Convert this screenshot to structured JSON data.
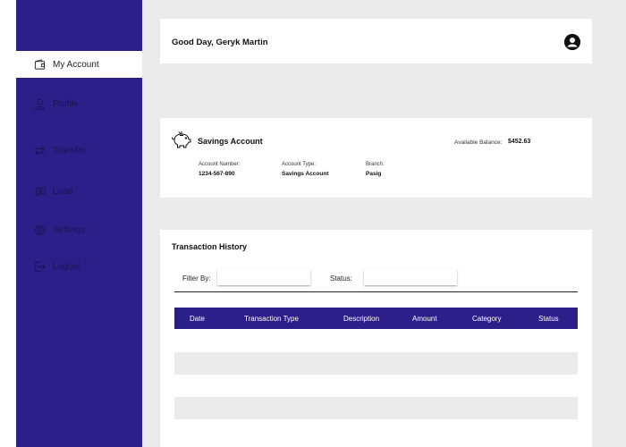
{
  "sidebar": {
    "items": [
      {
        "label": "My Account",
        "icon": "wallet-icon"
      },
      {
        "label": "Profile",
        "icon": "user-icon"
      },
      {
        "label": "Transfer",
        "icon": "transfer-icon"
      },
      {
        "label": "Load",
        "icon": "money-icon"
      },
      {
        "label": "Settings",
        "icon": "gear-icon"
      },
      {
        "label": "Logout",
        "icon": "logout-icon"
      }
    ]
  },
  "header": {
    "greeting": "Good Day, Geryk Martin",
    "avatar_icon": "user-avatar-icon"
  },
  "account": {
    "icon": "piggy-bank-icon",
    "title": "Savings Account",
    "balance_label": "Available Balance:",
    "balance_value": "$452.63",
    "number_label": "Account Number:",
    "number_value": "1234-567-890",
    "type_label": "Account Type:",
    "type_value": "Savings Account",
    "branch_label": "Branch:",
    "branch_value": "Pasig"
  },
  "transactions": {
    "title": "Transaction History",
    "filter_label": "Filter By:",
    "filter_value": "",
    "status_label": "Status:",
    "status_value": "",
    "columns": [
      "Date",
      "Transaction Type",
      "Description",
      "Amount",
      "Category",
      "Status"
    ],
    "rows": []
  },
  "colors": {
    "primary": "#2c1f8a",
    "background": "#ebebeb",
    "card": "#ffffff"
  }
}
